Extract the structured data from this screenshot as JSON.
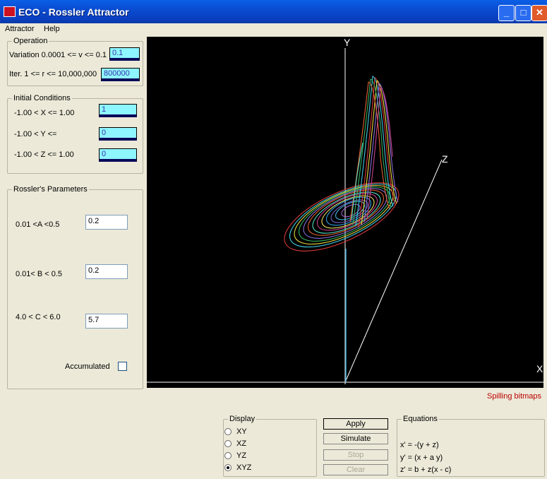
{
  "window": {
    "title": "ECO - Rossler Attractor"
  },
  "menu": [
    "Attractor",
    "Help"
  ],
  "operation": {
    "legend": "Operation",
    "variation_label": "Variation  0.0001 <= v <= 0.1",
    "variation_value": "0.1",
    "iter_label": "Iter. 1 <= r <= 10,000,000",
    "iter_value": "800000"
  },
  "initial": {
    "legend": "Initial Conditions",
    "x_label": "-1.00 < X <= 1.00",
    "x_value": "1",
    "y_label": "-1.00 < Y <=",
    "y_value": "0",
    "z_label": "-1.00 < Z <= 1.00",
    "z_value": "0"
  },
  "rossler": {
    "legend": "Rossler's Parameters",
    "a_label": "0.01 <A <0.5",
    "a_value": "0.2",
    "b_label": "0.01< B < 0.5",
    "b_value": "0.2",
    "c_label": "4.0 < C < 6.0",
    "c_value": "5.7",
    "accum_label": "Accumulated",
    "accum_checked": false
  },
  "plot": {
    "axis_x": "X",
    "axis_y": "Y",
    "axis_z": "Z"
  },
  "status_text": "Spilling bitmaps",
  "display": {
    "legend": "Display",
    "options": [
      "XY",
      "XZ",
      "YZ",
      "XYZ"
    ],
    "selected": "XYZ"
  },
  "buttons": {
    "apply": "Apply",
    "simulate": "Simulate",
    "stop": "Stop",
    "clear": "Clear"
  },
  "equations": {
    "legend": "Equations",
    "eq1": "x' = -(y + z)",
    "eq2": "y' = (x + a y)",
    "eq3": "z' = b + z(x - c)"
  }
}
